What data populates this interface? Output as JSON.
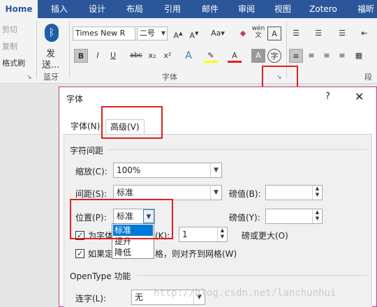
{
  "ribbon": {
    "tabs": [
      "Home",
      "插入",
      "设计",
      "布局",
      "引用",
      "邮件",
      "审阅",
      "视图",
      "Zotero",
      "福昕"
    ],
    "clipboard": {
      "cut": "剪切",
      "copy": "复制",
      "format_painter": "格式刷"
    },
    "bluetooth": {
      "label1": "发",
      "label2": "送...",
      "group": "蓝牙"
    },
    "font": {
      "name": "Times New R",
      "size": "二号",
      "group_label": "字体",
      "buttons": [
        "B",
        "I",
        "U",
        "abc",
        "x₂",
        "x²",
        "A",
        "A",
        "A",
        "Aa",
        "wén",
        "A",
        "字"
      ]
    },
    "paragraph_label": "段落"
  },
  "dialog": {
    "title": "字体",
    "help": "?",
    "close": "✕",
    "tabs": [
      "字体(N)",
      "高级(V)"
    ],
    "char_spacing": {
      "section": "字符间距",
      "scale_label": "缩放(C):",
      "scale_value": "100%",
      "spacing_label": "间距(S):",
      "spacing_value": "标准",
      "spacing_points_label": "磅值(B):",
      "position_label": "位置(P):",
      "position_value": "标准",
      "position_points_label": "磅值(Y):",
      "position_options": [
        "标准",
        "提升",
        "降低"
      ],
      "kerning_label": "为字体调整字间距(K):",
      "kerning_value": "1",
      "kerning_suffix": "磅或更大(O)",
      "grid_label": "如果定义了文档网格，则对齐到网格(W)"
    },
    "opentype": {
      "section": "OpenType 功能",
      "ligature_label": "连字(L):",
      "ligature_value": "无"
    }
  },
  "watermark": "http://blog.csdn.net/lanchunhui"
}
